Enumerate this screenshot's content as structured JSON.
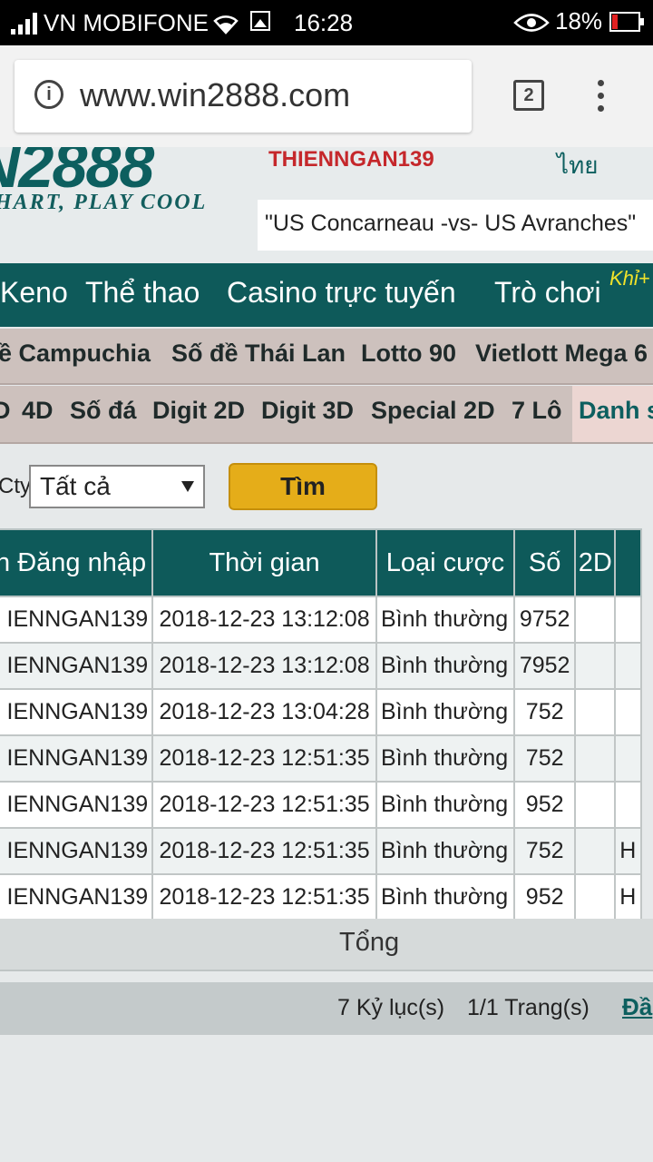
{
  "status_bar": {
    "carrier": "VN MOBIFONE",
    "time": "16:28",
    "battery": "18%",
    "icons": [
      "signal-icon",
      "wifi-icon",
      "gallery-icon",
      "eye-icon",
      "battery-icon"
    ]
  },
  "browser": {
    "url": "www.win2888.com",
    "tab_count": "2"
  },
  "header": {
    "logo": "N2888",
    "slogan": "HART, PLAY COOL",
    "username": "THIENNGAN139",
    "language": "ไทย",
    "marquee": "\"US Concarneau -vs- US Avranches\""
  },
  "main_nav": {
    "items": [
      "Keno",
      "Thể thao",
      "Casino trực tuyến",
      "Trò chơi"
    ],
    "badge": "Khỉ+"
  },
  "sub_nav_1": {
    "items": [
      "ề Campuchia",
      "Số đề Thái Lan",
      "Lotto 90",
      "Vietlott Mega 6"
    ]
  },
  "sub_nav_2": {
    "items": [
      "D",
      "4D",
      "Số đá",
      "Digit 2D",
      "Digit 3D",
      "Special 2D",
      "7 Lô",
      "Danh s"
    ]
  },
  "filter": {
    "label": "Cty",
    "select_value": "Tất cả",
    "search_button": "Tìm"
  },
  "table": {
    "headers": [
      "n Đăng nhập",
      "Thời gian",
      "Loại cược",
      "Số",
      "2D",
      ""
    ],
    "rows": [
      {
        "user": "IENNGAN139",
        "time": "2018-12-23 13:12:08",
        "type": "Bình thường",
        "number": "9752",
        "d2": "",
        "extra": ""
      },
      {
        "user": "IENNGAN139",
        "time": "2018-12-23 13:12:08",
        "type": "Bình thường",
        "number": "7952",
        "d2": "",
        "extra": ""
      },
      {
        "user": "IENNGAN139",
        "time": "2018-12-23 13:04:28",
        "type": "Bình thường",
        "number": "752",
        "d2": "",
        "extra": ""
      },
      {
        "user": "IENNGAN139",
        "time": "2018-12-23 12:51:35",
        "type": "Bình thường",
        "number": "752",
        "d2": "",
        "extra": ""
      },
      {
        "user": "IENNGAN139",
        "time": "2018-12-23 12:51:35",
        "type": "Bình thường",
        "number": "952",
        "d2": "",
        "extra": ""
      },
      {
        "user": "IENNGAN139",
        "time": "2018-12-23 12:51:35",
        "type": "Bình thường",
        "number": "752",
        "d2": "",
        "extra": "H"
      },
      {
        "user": "IENNGAN139",
        "time": "2018-12-23 12:51:35",
        "type": "Bình thường",
        "number": "952",
        "d2": "",
        "extra": "H"
      }
    ]
  },
  "summary": {
    "total_label": "Tổng",
    "records": "7 Kỷ lục(s)",
    "pages": "1/1 Trang(s)",
    "link": "Đầ"
  },
  "colors": {
    "nav_bg": "#0e5a5a",
    "subnav_bg": "#cdc1bd",
    "search_button": "#e5ad19",
    "username_red": "#c5272b"
  }
}
